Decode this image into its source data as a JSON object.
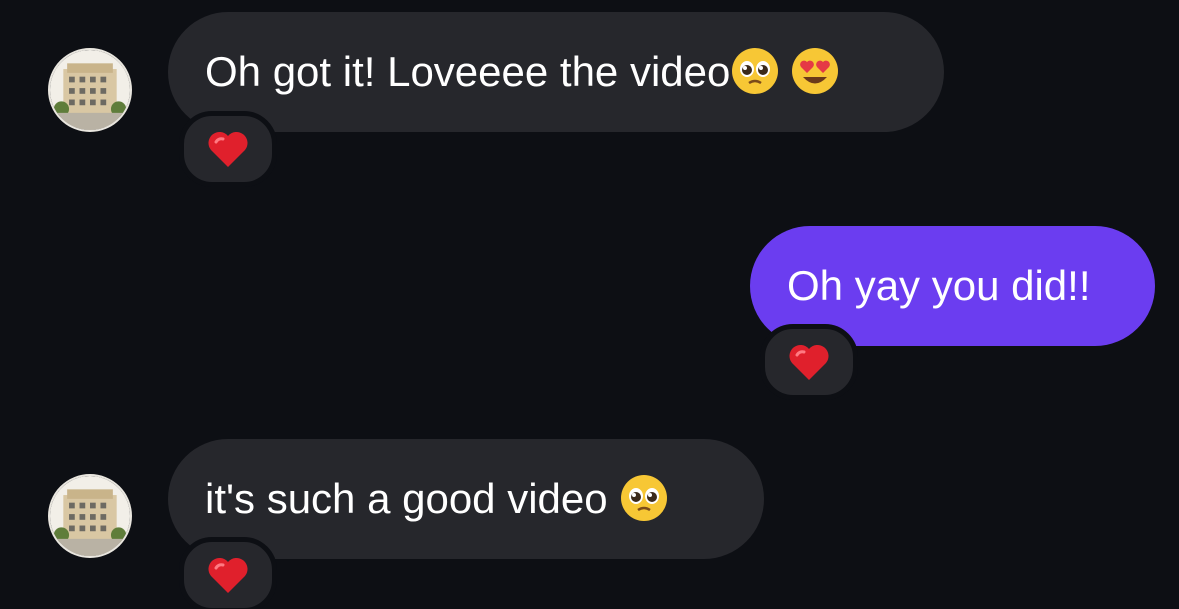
{
  "messages": [
    {
      "direction": "incoming",
      "text": "Oh got it! Loveeee the video",
      "emojis": [
        "pleading-face-icon",
        "heart-eyes-icon"
      ],
      "reaction": "red-heart-icon"
    },
    {
      "direction": "outgoing",
      "text": "Oh yay you did!!",
      "emojis": [],
      "reaction": "red-heart-icon"
    },
    {
      "direction": "incoming",
      "text": "it's such a good video ",
      "emojis": [
        "pleading-face-icon"
      ],
      "reaction": "red-heart-icon"
    }
  ],
  "colors": {
    "background": "#0d0f14",
    "incoming_bubble": "#26272c",
    "outgoing_bubble": "#6b3df0",
    "text": "#ffffff",
    "reaction_heart": "#e0202c"
  }
}
